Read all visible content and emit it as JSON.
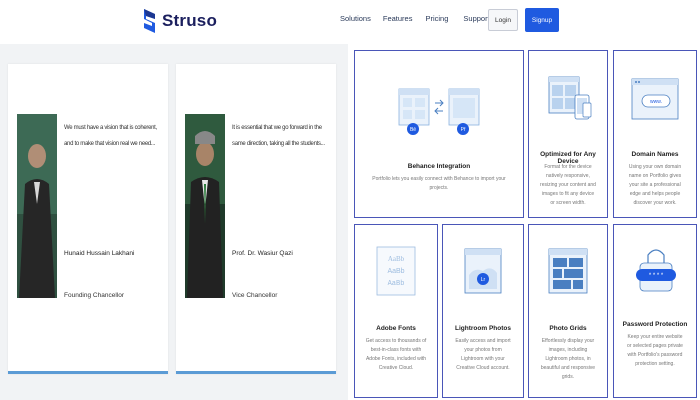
{
  "header": {
    "brand": "Struso",
    "nav": [
      "Solutions",
      "Features",
      "Pricing",
      "Support"
    ],
    "login_label": "Login",
    "signup_label": "Signup",
    "brand_color": "#1f5ae0"
  },
  "testimonials": [
    {
      "quote": "We must have a vision that is coherent, and to make that vision real we need...",
      "name": "Hunaid Hussain Lakhani",
      "title": "Founding Chancellor"
    },
    {
      "quote": "It is essential that we go forward in the same direction, taking all the students...",
      "name": "Prof. Dr. Wasiur Qazi",
      "title": "Vice Chancellor"
    }
  ],
  "features": [
    {
      "title": "Behance Integration",
      "desc": "Portfolio lets you easily connect with Behance to import your projects.",
      "icon": "behance-sync-icon"
    },
    {
      "title": "Optimized for Any Device",
      "desc": "Format for the device natively responsive, resizing your content and images to fit any device or screen width.",
      "icon": "devices-icon"
    },
    {
      "title": "Domain Names",
      "desc": "Using your own domain name on Portfolio gives your site a professional edge and helps people discover your work.",
      "icon": "domain-icon"
    },
    {
      "title": "Adobe Fonts",
      "desc": "Get access to thousands of best-in-class fonts with Adobe Fonts, included with Creative Cloud.",
      "icon": "fonts-icon"
    },
    {
      "title": "Lightroom Photos",
      "desc": "Easily access and import your photos from Lightroom with your Creative Cloud account.",
      "icon": "lightroom-icon"
    },
    {
      "title": "Photo Grids",
      "desc": "Effortlessly display your images, including Lightroom photos, in beautiful and responsive grids.",
      "icon": "photo-grid-icon"
    },
    {
      "title": "Password Protection",
      "desc": "Keep your entire website or selected pages private with Portfolio's password protection setting.",
      "icon": "lock-icon"
    }
  ]
}
